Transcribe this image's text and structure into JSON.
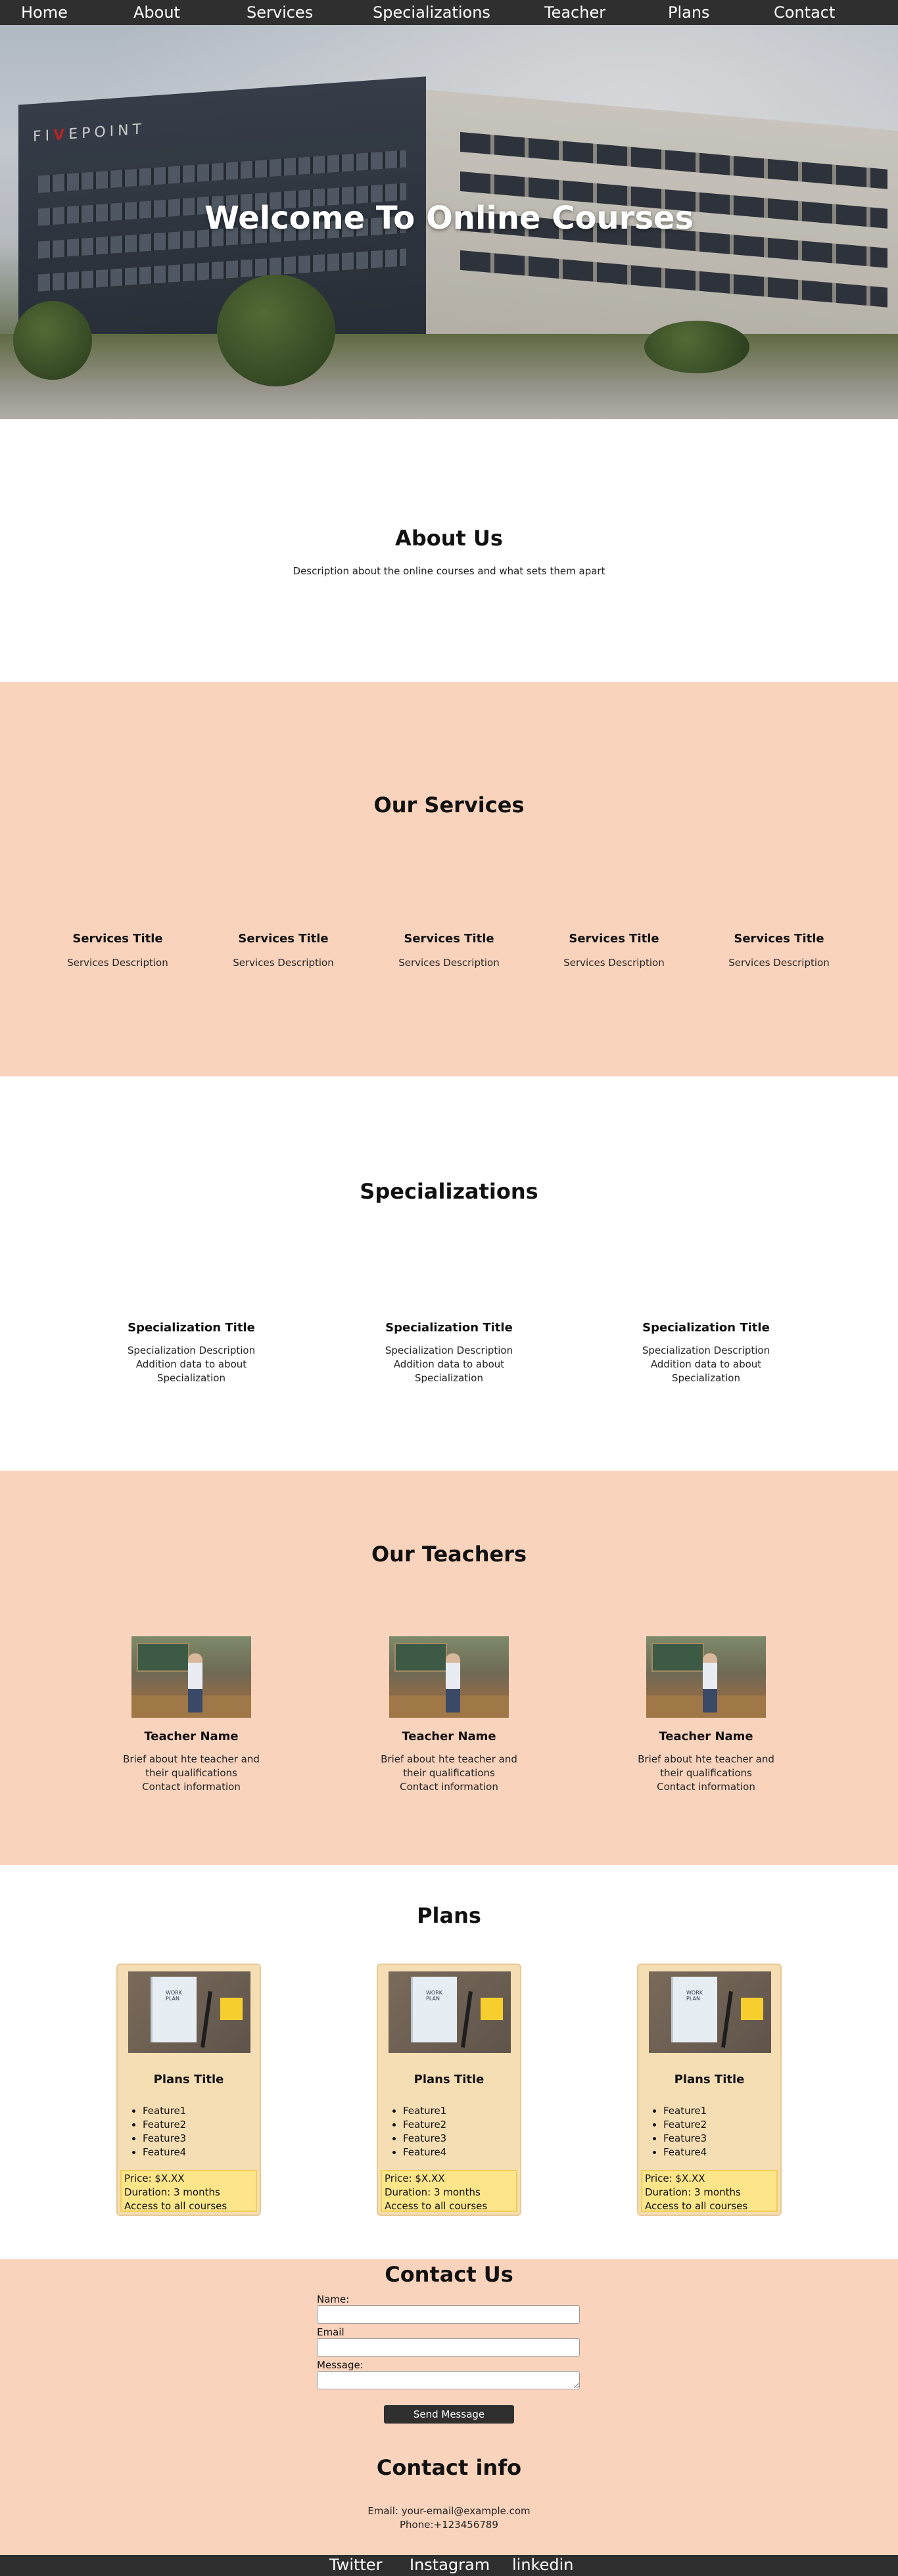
{
  "nav": [
    "Home",
    "About",
    "Services",
    "Specializations",
    "Teacher",
    "Plans",
    "Contact"
  ],
  "hero": {
    "title": "Welcome To Online Courses",
    "building_sign_prefix": "FI",
    "building_sign_accent": "V",
    "building_sign_suffix": "EPOINT"
  },
  "about": {
    "title": "About Us",
    "description": "Description about the online courses and what sets them apart"
  },
  "services": {
    "title": "Our Services",
    "items": [
      {
        "title": "Services Title",
        "description": "Services Description"
      },
      {
        "title": "Services Title",
        "description": "Services Description"
      },
      {
        "title": "Services Title",
        "description": "Services Description"
      },
      {
        "title": "Services Title",
        "description": "Services Description"
      },
      {
        "title": "Services Title",
        "description": "Services Description"
      }
    ]
  },
  "specializations": {
    "title": "Specializations",
    "items": [
      {
        "title": "Specialization Title",
        "line1": "Specialization Description",
        "line2": "Addition data to about",
        "line3": "Specialization"
      },
      {
        "title": "Specialization Title",
        "line1": "Specialization Description",
        "line2": "Addition data to about",
        "line3": "Specialization"
      },
      {
        "title": "Specialization Title",
        "line1": "Specialization Description",
        "line2": "Addition data to about",
        "line3": "Specialization"
      }
    ]
  },
  "teachers": {
    "title": "Our Teachers",
    "items": [
      {
        "name": "Teacher Name",
        "line1": "Brief about hte teacher and",
        "line2": "their qualifications",
        "line3": "Contact information"
      },
      {
        "name": "Teacher Name",
        "line1": "Brief about hte teacher and",
        "line2": "their qualifications",
        "line3": "Contact information"
      },
      {
        "name": "Teacher Name",
        "line1": "Brief about hte teacher and",
        "line2": "their qualifications",
        "line3": "Contact information"
      }
    ]
  },
  "plans": {
    "title": "Plans",
    "image_text": "WORK PLAN",
    "items": [
      {
        "title": "Plans Title",
        "features": [
          "Feature1",
          "Feature2",
          "Feature3",
          "Feature4"
        ],
        "price": "Price: $X.XX",
        "duration": "Duration: 3 months",
        "access": "Access to all courses"
      },
      {
        "title": "Plans Title",
        "features": [
          "Feature1",
          "Feature2",
          "Feature3",
          "Feature4"
        ],
        "price": "Price: $X.XX",
        "duration": "Duration: 3 months",
        "access": "Access to all courses"
      },
      {
        "title": "Plans Title",
        "features": [
          "Feature1",
          "Feature2",
          "Feature3",
          "Feature4"
        ],
        "price": "Price: $X.XX",
        "duration": "Duration: 3 months",
        "access": "Access to all courses"
      }
    ]
  },
  "contact": {
    "title": "Contact Us",
    "name_label": "Name:",
    "email_label": "Email",
    "message_label": "Message:",
    "send_label": "Send Message"
  },
  "contact_info": {
    "title": "Contact info",
    "email": "Email: your-email@example.com",
    "phone": "Phone:+123456789"
  },
  "footer": [
    "Twitter",
    "Instagram",
    "linkedin"
  ],
  "colors": {
    "nav_bg": "#2f2f2f",
    "peach": "#fad3bd",
    "plan_card": "#f5deb3",
    "plan_price": "#fde68a"
  }
}
